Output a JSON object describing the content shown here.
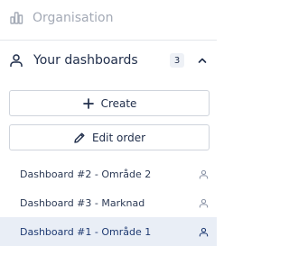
{
  "organisation": {
    "label": "Organisation",
    "icon": "org-chart-icon"
  },
  "dashboards_section": {
    "title": "Your dashboards",
    "icon": "user-icon",
    "count": "3",
    "expanded": true,
    "chevron_icon": "chevron-up-icon"
  },
  "buttons": {
    "create_label": "Create",
    "create_icon": "plus-icon",
    "edit_order_label": "Edit order",
    "edit_order_icon": "pencil-icon"
  },
  "dashboards": [
    {
      "label": "Dashboard #2 - Område 2",
      "icon": "user-icon",
      "active": false
    },
    {
      "label": "Dashboard #3 - Marknad",
      "icon": "user-icon",
      "active": false
    },
    {
      "label": "Dashboard #1 - Område 1",
      "icon": "user-icon",
      "active": true
    }
  ],
  "colors": {
    "text_primary": "#1f2d4a",
    "text_muted": "#a4aab6",
    "active_bg": "#e9eef6",
    "border": "#cfd4dc"
  }
}
